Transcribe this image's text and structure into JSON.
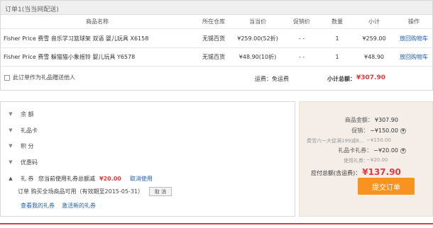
{
  "order": {
    "title": "订单1(当当网配送)",
    "columns": [
      "商品名称",
      "所在仓库",
      "当当价",
      "促销价",
      "数量",
      "小计",
      "操作"
    ],
    "rows": [
      {
        "name": "Fisher Price 费雪 音乐学习篮球架 双语 婴儿玩具 X6158",
        "warehouse": "无锡百货",
        "price": "¥259.00(52折)",
        "promo": "- -",
        "qty": "1",
        "subtotal": "¥259.00",
        "action": "放回购物车"
      },
      {
        "name": "Fisher Price 费雪 躲猫猫小象摇铃 婴儿玩具 Y6578",
        "warehouse": "无锡百货",
        "price": "¥48.90(10折)",
        "promo": "- -",
        "qty": "1",
        "subtotal": "¥48.90",
        "action": "放回购物车"
      }
    ],
    "gift_label": "此订单作为礼品赠送他人",
    "shipping_label": "运费：免运费",
    "total_label": "小计总额：",
    "total_value": "¥307.90"
  },
  "payment": {
    "items": [
      "余 额",
      "礼品卡",
      "积 分",
      "优惠码",
      "礼 券"
    ],
    "coupon_used_text": "您当前使用礼券总额减",
    "coupon_used_amount": "¥20.00",
    "cancel_use": "取消使用",
    "coupon_detail": "订单  购买全场商品可用（有效期至2015-05-31）",
    "cancel_button": "取 消",
    "link_my_coupons": "查看我的礼券",
    "link_activate": "激活新的礼券"
  },
  "summary": {
    "goods_label": "商品金额：",
    "goods_value": "¥307.90",
    "promo_label": "促销：",
    "promo_value": "−¥150.00",
    "promo_sub_label": "费雪六一大促满199减8...",
    "promo_sub_value": "−¥150.00",
    "giftcard_label": "礼品卡礼券：",
    "giftcard_value": "−¥20.00",
    "coupon_sub_label": "使用礼券：",
    "coupon_sub_value": "−¥20.00",
    "payable_label": "应付总额(含运费)：",
    "payable_value": "¥137.90",
    "submit_label": "提交订单"
  }
}
